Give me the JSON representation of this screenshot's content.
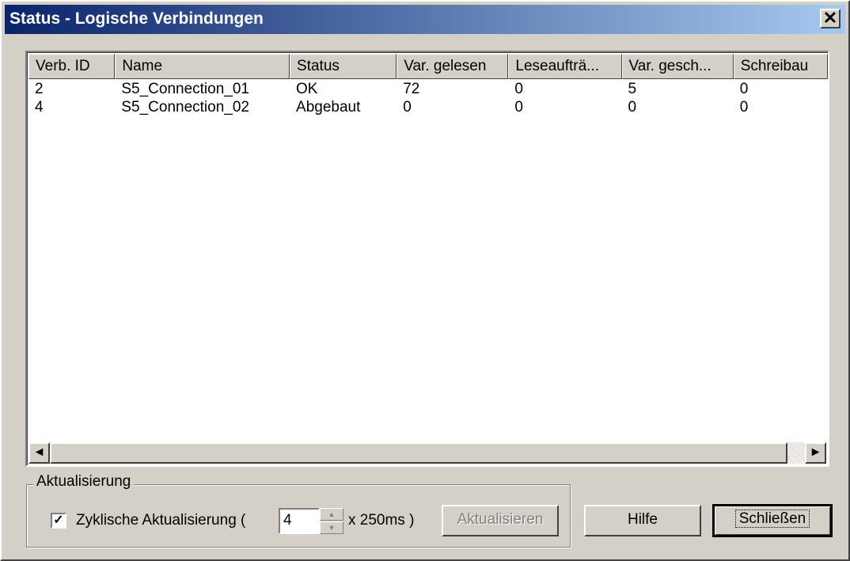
{
  "window": {
    "title": "Status - Logische Verbindungen",
    "close_label": "✕"
  },
  "table": {
    "columns": [
      "Verb. ID",
      "Name",
      "Status",
      "Var. gelesen",
      "Leseaufträ...",
      "Var. gesch...",
      "Schreibau"
    ],
    "rows": [
      [
        "2",
        "S5_Connection_01",
        "OK",
        "72",
        "0",
        "5",
        "0"
      ],
      [
        "4",
        "S5_Connection_02",
        "Abgebaut",
        "0",
        "0",
        "0",
        "0"
      ]
    ]
  },
  "scrollbar": {
    "left_icon": "◄",
    "right_icon": "►"
  },
  "update_group": {
    "label": "Aktualisierung",
    "checkbox_checked": true,
    "checkbox_label": "Zyklische Aktualisierung (",
    "interval_value": "4",
    "interval_unit": "x 250ms )",
    "refresh_button": "Aktualisieren"
  },
  "buttons": {
    "help": "Hilfe",
    "close": "Schließen"
  }
}
